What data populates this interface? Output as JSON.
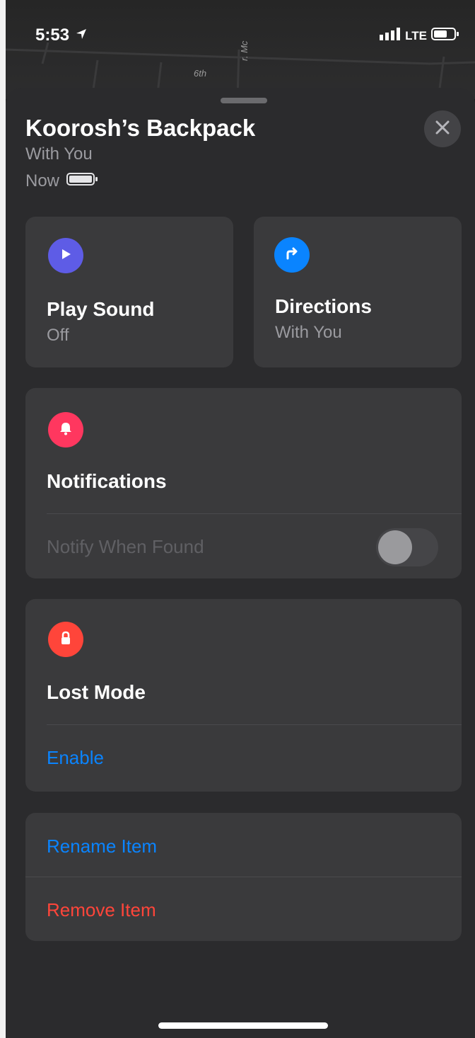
{
  "status_bar": {
    "time": "5:53",
    "carrier": "LTE"
  },
  "map": {
    "street_label_1": "6th",
    "street_label_2": "r. Mc"
  },
  "item": {
    "name": "Koorosh’s Backpack",
    "status": "With You",
    "last_seen": "Now"
  },
  "actions": {
    "play_sound": {
      "label": "Play Sound",
      "value": "Off"
    },
    "directions": {
      "label": "Directions",
      "value": "With You"
    }
  },
  "notifications": {
    "title": "Notifications",
    "notify_when_found": {
      "label": "Notify When Found",
      "enabled": false
    }
  },
  "lost_mode": {
    "title": "Lost Mode",
    "action": "Enable"
  },
  "manage": {
    "rename": "Rename Item",
    "remove": "Remove Item"
  },
  "colors": {
    "play_sound_icon": "#5e5ce6",
    "directions_icon": "#0a84ff",
    "notifications_icon": "#ff375f",
    "lost_mode_icon": "#ff453a",
    "link_blue": "#0a84ff",
    "destructive_red": "#ff453a"
  }
}
